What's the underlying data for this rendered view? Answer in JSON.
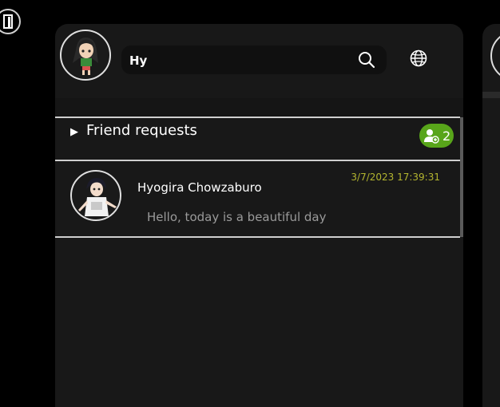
{
  "search": {
    "value": "Hy"
  },
  "friend_requests": {
    "label": "Friend requests",
    "count": "2"
  },
  "chats": [
    {
      "name": "Hyogira Chowzaburo",
      "timestamp": "3/7/2023 17:39:31",
      "last_message": "Hello, today is a beautiful day"
    }
  ],
  "icons": {
    "exit": "door-exit-icon",
    "search": "search-icon",
    "language": "globe-icon",
    "friend_request": "user-add-icon",
    "expand": "triangle-right-icon"
  },
  "colors": {
    "background": "#000000",
    "panel": "#181818",
    "badge": "#58a51a",
    "timestamp": "#b3b52f",
    "message": "#9a9a9a"
  }
}
